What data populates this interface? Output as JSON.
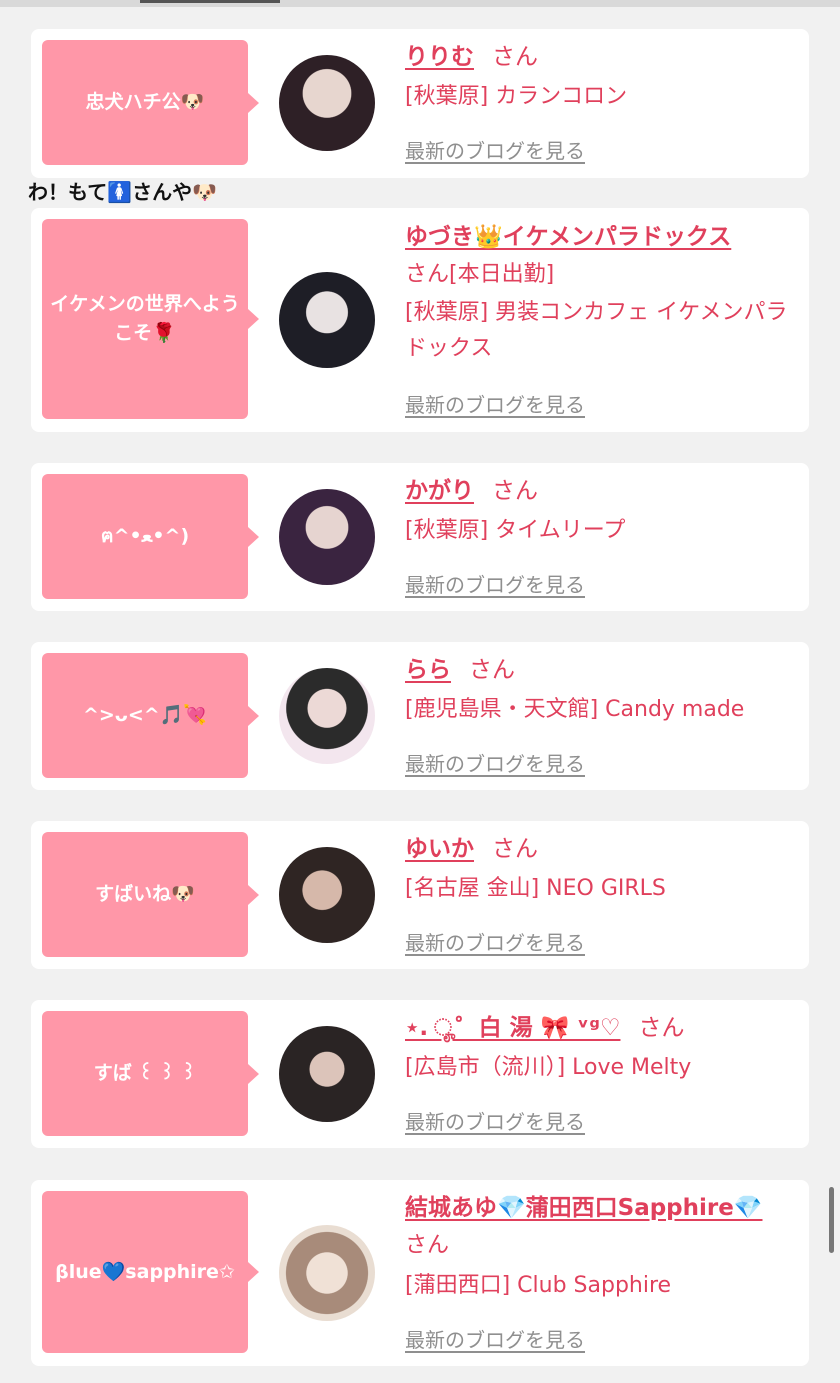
{
  "items": [
    {
      "comment": "忠犬ハチ公🐶",
      "name": "りりむ",
      "suffix": "さん",
      "shop": "[秋葉原] カランコロン",
      "blog_link": "最新のブログを見る",
      "avatar_icon": "avatar-photo",
      "colors": {
        "a": "#d9c7c2",
        "b": "#3a2a2e"
      }
    },
    {
      "comment": "イケメンの世界へようこそ🌹",
      "name": "ゆづき👑イケメンパラドックス",
      "suffix": "さん[本日出勤]",
      "shop": "[秋葉原] 男装コンカフェ イケメンパラドックス",
      "blog_link": "最新のブログを見る",
      "avatar_icon": "avatar-photo",
      "colors": {
        "a": "#2a2a33",
        "b": "#dedede"
      }
    },
    {
      "comment": "ฅ^•ﻌ•^)",
      "name": "かがり",
      "suffix": "さん",
      "shop": "[秋葉原] タイムリープ",
      "blog_link": "最新のブログを見る",
      "avatar_icon": "avatar-photo",
      "colors": {
        "a": "#2c2230",
        "b": "#c9a3d9"
      }
    },
    {
      "comment": "^>ᴗ<^🎵💘",
      "name": "らら",
      "suffix": "さん",
      "shop": "[鹿児島県・天文館] Candy made",
      "blog_link": "最新のブログを見る",
      "avatar_icon": "avatar-photo",
      "colors": {
        "a": "#f4e7ef",
        "b": "#2b2b2b"
      }
    },
    {
      "comment": "すばいね🐶",
      "name": "ゆいか",
      "suffix": "さん",
      "shop": "[名古屋 金山] NEO GIRLS",
      "blog_link": "最新のブログを見る",
      "avatar_icon": "avatar-photo",
      "colors": {
        "a": "#3b2e2c",
        "b": "#c9a89a"
      }
    },
    {
      "comment": "すば ꒰ ꒱ ꒱",
      "name": "⋆. ೄ゜白 湯 🎀 ᵛᵍ♡",
      "suffix": "さん",
      "shop": "[広島市（流川）] Love Melty",
      "blog_link": "最新のブログを見る",
      "avatar_icon": "avatar-photo",
      "colors": {
        "a": "#2f2a2a",
        "b": "#d8c2b8"
      }
    },
    {
      "comment": "βlue💙sapphire✩",
      "name": "結城あゆ💎蒲田西口Sapphire💎",
      "suffix": "さん",
      "shop": "[蒲田西口] Club Sapphire",
      "blog_link": "最新のブログを見る",
      "avatar_icon": "avatar-photo",
      "colors": {
        "a": "#e9ddd2",
        "b": "#a78b7a"
      }
    }
  ],
  "standalone_comment": "わ！もて🚺さんや🐶"
}
